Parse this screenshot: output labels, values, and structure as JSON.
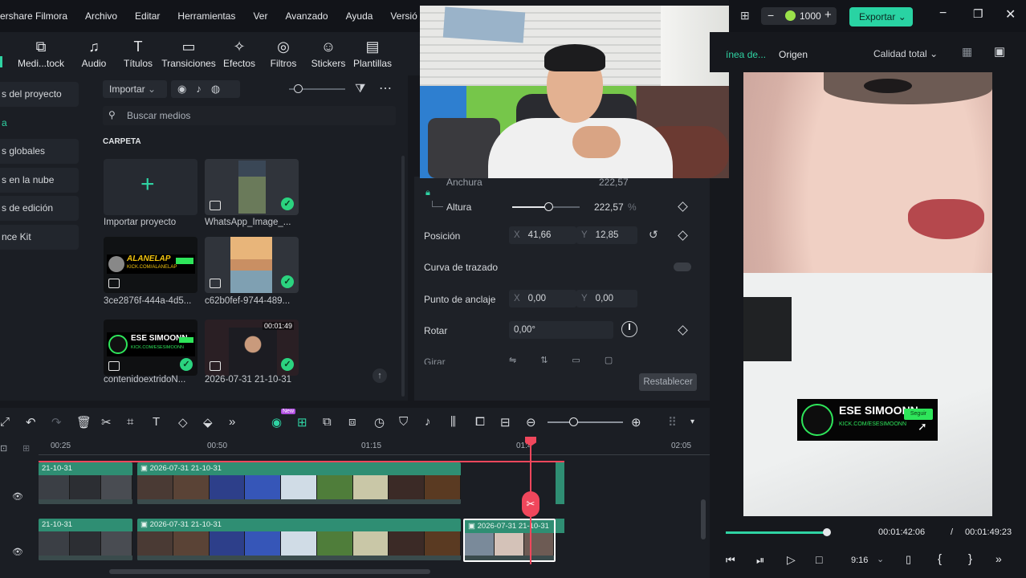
{
  "menu": {
    "app": "ershare Filmora",
    "items": [
      "Archivo",
      "Editar",
      "Herramientas",
      "Ver",
      "Avanzado",
      "Ayuda",
      "Versió"
    ]
  },
  "toolbar": {
    "items": [
      "Medi...tock",
      "Audio",
      "Títulos",
      "Transiciones",
      "Efectos",
      "Filtros",
      "Stickers",
      "Plantillas"
    ]
  },
  "sidebar": {
    "items": [
      "s del proyecto",
      "a",
      "s globales",
      "s en la nube",
      "s de edición",
      "nce Kit"
    ]
  },
  "media": {
    "import_label": "Importar",
    "search_placeholder": "Buscar medios",
    "folder_label": "CARPETA",
    "items": [
      {
        "name": "Importar proyecto"
      },
      {
        "name": "WhatsApp_Image_..."
      },
      {
        "name": "3ce2876f-444a-4d5..."
      },
      {
        "name": "c62b0fef-9744-489..."
      },
      {
        "name": "contenidoextridoN..."
      },
      {
        "name": "2026-07-31 21-10-31",
        "duration": "00:01:49"
      }
    ],
    "thumb_texts": {
      "alanelap": "ALANELAP",
      "alanelap_sub": "KICK.COM/ALANELAP",
      "simoonn": "ESE SIMOONN",
      "simoonn_sub": "KICK.COM/ESESIMOONN"
    }
  },
  "props": {
    "anchura_label": "Anchura",
    "anchura_value": "222,57",
    "altura_label": "Altura",
    "altura_value": "222,57",
    "altura_unit": "%",
    "posicion_label": "Posición",
    "pos_x": "41,66",
    "pos_y": "12,85",
    "curva_label": "Curva de trazado",
    "anclaje_label": "Punto de anclaje",
    "anc_x": "0,00",
    "anc_y": "0,00",
    "rotar_label": "Rotar",
    "rotar_value": "0,00°",
    "girar_label": "Girar",
    "reset_label": "Restablecer",
    "x_axis": "X",
    "y_axis": "Y"
  },
  "right": {
    "credits": "1000",
    "export_label": "Exportar",
    "tab_linea": "ínea de...",
    "tab_origen": "Origen",
    "quality_label": "Calidad total",
    "current_time": "00:01:42:06",
    "separator": "/",
    "total_time": "00:01:49:23",
    "aspect": "9:16",
    "progress": 0.97
  },
  "overlay": {
    "title": "ESE SIMOONN",
    "sub": "KICK.COM/ESESIMOONN",
    "follow": "Seguir"
  },
  "timeline": {
    "ruler": [
      "00:25",
      "00:50",
      "01:15",
      "01:4",
      "02:05"
    ],
    "clip_label": "2026-07-31 21-10-31",
    "clip_label_short": "21-10-31",
    "new_badge": "New"
  },
  "colors": {
    "accent": "#2fd3a3",
    "export_bg": "#29d3a3",
    "playhead": "#f0475c",
    "clip": "#2f8e73"
  }
}
